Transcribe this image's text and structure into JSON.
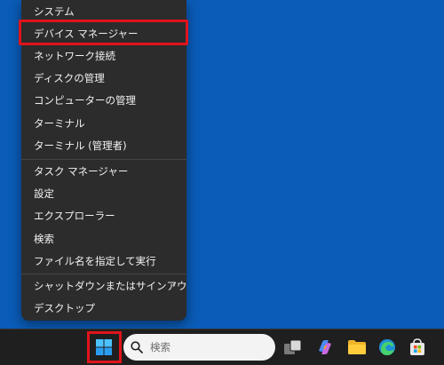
{
  "context_menu": {
    "items": [
      {
        "label": "システム"
      },
      {
        "label": "デバイス マネージャー"
      },
      {
        "label": "ネットワーク接続"
      },
      {
        "label": "ディスクの管理"
      },
      {
        "label": "コンピューターの管理"
      },
      {
        "label": "ターミナル"
      },
      {
        "label": "ターミナル (管理者)"
      },
      {
        "label": "タスク マネージャー"
      },
      {
        "label": "設定"
      },
      {
        "label": "エクスプローラー"
      },
      {
        "label": "検索"
      },
      {
        "label": "ファイル名を指定して実行"
      },
      {
        "label": "シャットダウンまたはサインアウト",
        "submenu_icon": "›"
      },
      {
        "label": "デスクトップ"
      }
    ],
    "highlighted_item": "デバイス マネージャー"
  },
  "taskbar": {
    "start_icon": "windows-logo-icon",
    "search": {
      "placeholder": "検索",
      "icon": "search-icon"
    },
    "apps": [
      {
        "icon": "task-view-icon"
      },
      {
        "icon": "copilot-icon"
      },
      {
        "icon": "file-explorer-icon"
      },
      {
        "icon": "edge-icon"
      },
      {
        "icon": "store-icon"
      }
    ]
  },
  "colors": {
    "desktop": "#0a5cb8",
    "menu_bg": "#2c2c2c",
    "highlight": "#e0141b",
    "taskbar": "#1f1f1f"
  }
}
